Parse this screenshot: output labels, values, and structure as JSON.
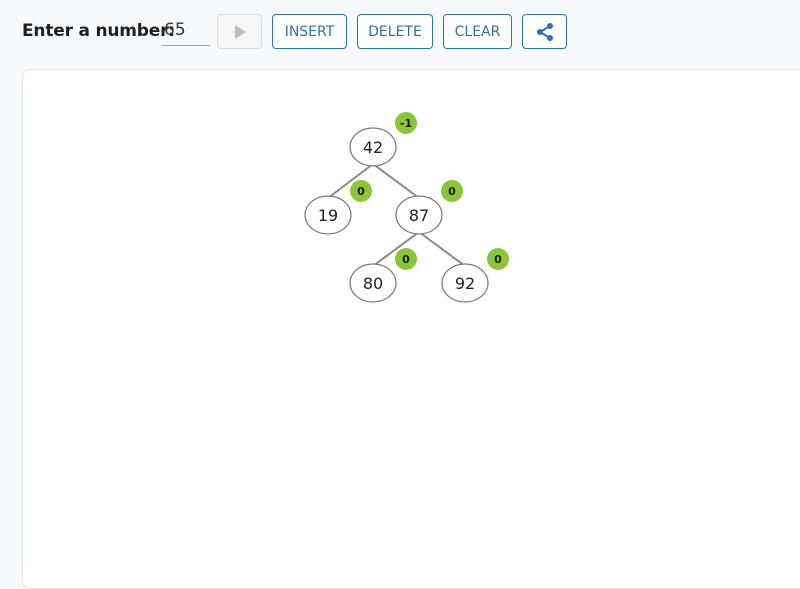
{
  "toolbar": {
    "label": "Enter a number:",
    "input_value": "65",
    "play_icon": "play-icon",
    "insert_label": "INSERT",
    "delete_label": "DELETE",
    "clear_label": "CLEAR",
    "share_icon": "share-icon"
  },
  "colors": {
    "accent": "#2f6fb0",
    "badge": "#8cc43c",
    "edge": "#8a8a8a",
    "node_border": "#7a7a7a"
  },
  "tree": {
    "nodes": [
      {
        "id": "n42",
        "value": "42",
        "balance": "-1"
      },
      {
        "id": "n19",
        "value": "19",
        "balance": "0"
      },
      {
        "id": "n87",
        "value": "87",
        "balance": "0"
      },
      {
        "id": "n80",
        "value": "80",
        "balance": "0"
      },
      {
        "id": "n92",
        "value": "92",
        "balance": "0"
      }
    ],
    "edges": [
      {
        "from": "n42",
        "to": "n19"
      },
      {
        "from": "n42",
        "to": "n87"
      },
      {
        "from": "n87",
        "to": "n80"
      },
      {
        "from": "n87",
        "to": "n92"
      }
    ]
  }
}
